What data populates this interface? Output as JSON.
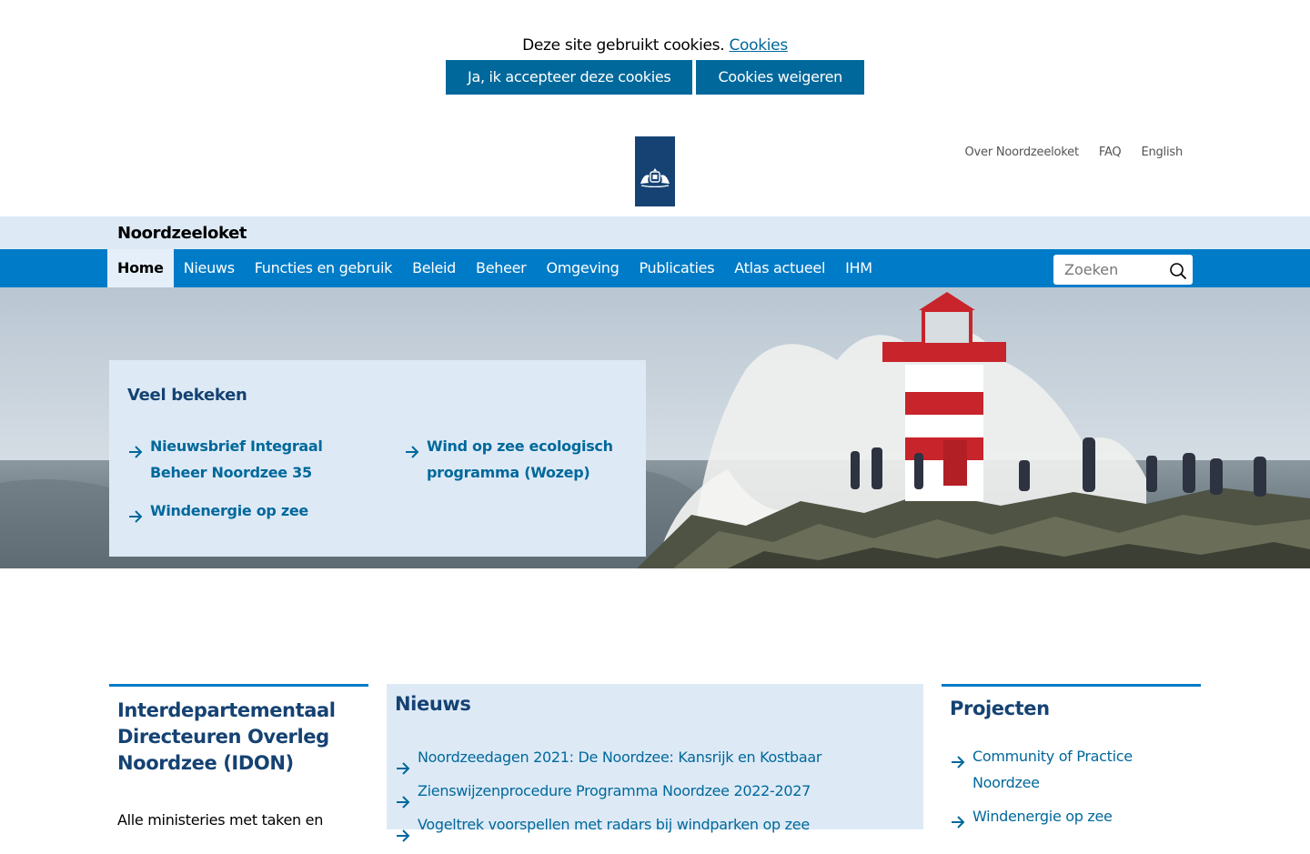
{
  "cookies": {
    "message": "Deze site gebruikt cookies.",
    "link_label": "Cookies",
    "accept_label": "Ja, ik accepteer deze cookies",
    "decline_label": "Cookies weigeren"
  },
  "utility_links": [
    "Over Noordzeeloket",
    "FAQ",
    "English"
  ],
  "site_name": "Noordzeeloket",
  "nav": {
    "items": [
      "Home",
      "Nieuws",
      "Functies en gebruik",
      "Beleid",
      "Beheer",
      "Omgeving",
      "Publicaties",
      "Atlas actueel",
      "IHM"
    ],
    "active": "Home"
  },
  "search": {
    "placeholder": "Zoeken"
  },
  "popular": {
    "title": "Veel bekeken",
    "links": [
      {
        "line1": "Nieuwsbrief Integraal",
        "line2": "Beheer Noordzee 35"
      },
      {
        "line1": "Wind op zee ecologisch",
        "line2": "programma (Wozep)"
      },
      {
        "line1": "Windenergie op zee",
        "line2": ""
      }
    ]
  },
  "idon": {
    "title_lines": [
      "Interdepartementaal",
      "Directeuren Overleg",
      "Noordzee (IDON)"
    ],
    "intro": "Alle ministeries met taken en"
  },
  "news": {
    "title": "Nieuws",
    "items": [
      "Noordzeedagen 2021: De Noordzee: Kansrijk en Kostbaar",
      "Zienswijzenprocedure Programma Noordzee 2022-2027",
      "Vogeltrek voorspellen met radars bij windparken op zee"
    ]
  },
  "projects": {
    "title": "Projecten",
    "items": [
      {
        "line1": "Community of Practice",
        "line2": "Noordzee"
      },
      {
        "line1": "Windenergie op zee",
        "line2": ""
      }
    ]
  },
  "colors": {
    "primary": "#01689b",
    "nav_blue": "#007bc7",
    "light_blue": "#ddeaf6",
    "dark_blue": "#154273"
  },
  "icons": [
    "logo-rijksoverheid",
    "search-icon",
    "arrow-right-icon"
  ]
}
